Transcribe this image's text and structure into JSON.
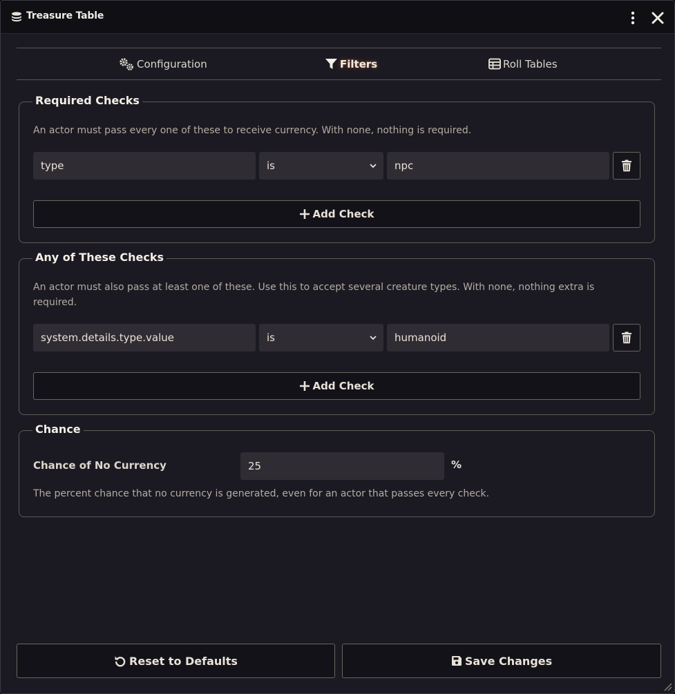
{
  "window": {
    "title": "Treasure Table",
    "icon": "coins-icon"
  },
  "tabs": [
    {
      "label": "Configuration",
      "icon": "cogs-icon",
      "active": false
    },
    {
      "label": "Filters",
      "icon": "filter-icon",
      "active": true
    },
    {
      "label": "Roll Tables",
      "icon": "table-icon",
      "active": false
    }
  ],
  "required": {
    "title": "Required Checks",
    "hint": "An actor must pass every one of these to receive currency. With none, nothing is required.",
    "rows": [
      {
        "path": "type",
        "operator": "is",
        "value": "npc"
      }
    ],
    "add_label": "Add Check"
  },
  "any": {
    "title": "Any of These Checks",
    "hint_line1": "An actor must also pass at least one of these. Use this to accept several creature types. With none, nothing extra is",
    "hint_line2": "required.",
    "rows": [
      {
        "path": "system.details.type.value",
        "operator": "is",
        "value": "humanoid"
      }
    ],
    "add_label": "Add Check"
  },
  "chance": {
    "title": "Chance",
    "label": "Chance of No Currency",
    "value": "25",
    "unit": "%",
    "hint": "The percent chance that no currency is generated, even for an actor that passes every check."
  },
  "footer": {
    "reset_label": "Reset to Defaults",
    "save_label": "Save Changes"
  },
  "colors": {
    "background": "#1b1a22",
    "titlebar": "#0f0f14",
    "field": "#302c33",
    "border": "#5f5a56",
    "accent_glow": "#ff7828"
  }
}
